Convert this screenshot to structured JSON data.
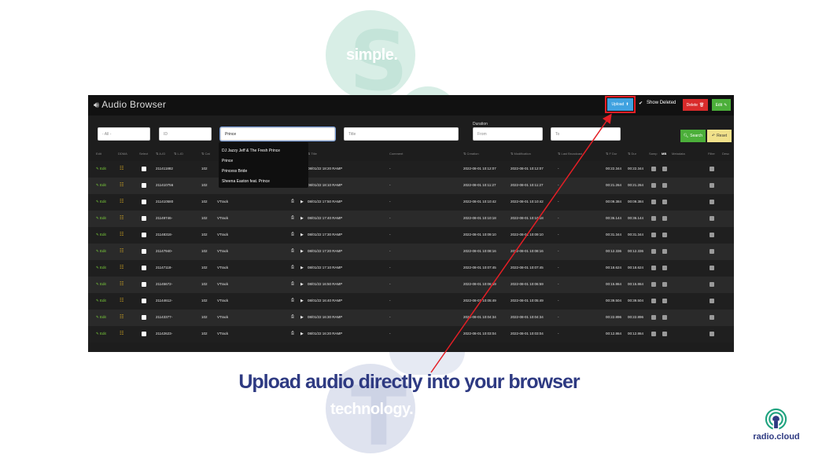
{
  "decor": {
    "top_word": "simple.",
    "top_letter": "S",
    "bottom_word": "technology.",
    "bottom_letter": "T"
  },
  "app": {
    "title": "Audio Browser",
    "toolbar": {
      "upload_label": "Upload",
      "show_deleted_label": "Show Deleted",
      "delete_label": "Delete",
      "edit_label": "Edit"
    },
    "filters": {
      "category": "- All -",
      "id_placeholder": "ID",
      "artist_value": "Prince",
      "title_placeholder": "Title",
      "duration_label": "Duration",
      "from_placeholder": "From",
      "to_placeholder": "To",
      "search_label": "Search",
      "reset_label": "Reset"
    },
    "autocomplete": [
      "DJ Jazzy Jeff & The Fresh Prince",
      "Prince",
      "Princess Bride",
      "Sheena Easton feat. Prince"
    ],
    "columns": {
      "edit": "Edit",
      "dima": "DDMA",
      "select": "Select",
      "aid": "A-ID",
      "lid": "L-ID",
      "cat": "Cat",
      "title": "Title",
      "comment": "Comment",
      "creation": "Creation",
      "modification": "Modification",
      "last_broadcast": "Last Broadcast",
      "fdur": "F Dur",
      "dur": "Dur",
      "samp": "Samp",
      "mb": "MB",
      "metadata": "Metadata",
      "filter": "Filter",
      "desc": "Desc"
    },
    "rows": [
      {
        "edit": "Edit",
        "aid": "211411882",
        "cat": "102",
        "type": "",
        "title": "08/01/22 18:20 RAMP",
        "comment": "-",
        "creation": "2022-08-01 10:12:07",
        "modification": "2022-08-01 10:12:07",
        "last": "-",
        "fdur": "00:22.344",
        "dur": "00:22.344"
      },
      {
        "edit": "Edit",
        "aid": "211410756",
        "cat": "102",
        "type": "",
        "title": "08/01/22 18:10 RAMP",
        "comment": "-",
        "creation": "2022-08-01 10:11:27",
        "modification": "2022-08-01 10:11:27",
        "last": "-",
        "fdur": "00:21.264",
        "dur": "00:21.264"
      },
      {
        "edit": "Edit",
        "aid": "211410580",
        "cat": "102",
        "type": "VTrack",
        "title": "08/01/22 17:50 RAMP",
        "comment": "-",
        "creation": "2022-08-01 10:10:42",
        "modification": "2022-08-01 10:10:42",
        "last": "-",
        "fdur": "00:09.384",
        "dur": "00:09.384"
      },
      {
        "edit": "Edit",
        "aid": "21149746-",
        "cat": "102",
        "type": "VTrack",
        "title": "08/01/22 17:40 RAMP",
        "comment": "-",
        "creation": "2022-08-01 10:10:18",
        "modification": "2022-08-01 10:10:18",
        "last": "-",
        "fdur": "00:36.144",
        "dur": "00:36.144"
      },
      {
        "edit": "Edit",
        "aid": "21148318-",
        "cat": "102",
        "type": "VTrack",
        "title": "08/01/22 17:30 RAMP",
        "comment": "-",
        "creation": "2022-08-01 10:09:10",
        "modification": "2022-08-01 10:09:10",
        "last": "-",
        "fdur": "00:31.344",
        "dur": "00:31.344"
      },
      {
        "edit": "Edit",
        "aid": "21147940-",
        "cat": "102",
        "type": "VTrack",
        "title": "08/01/22 17:20 RAMP",
        "comment": "-",
        "creation": "2022-08-01 10:08:16",
        "modification": "2022-08-01 10:08:16",
        "last": "-",
        "fdur": "00:12.336",
        "dur": "00:12.336"
      },
      {
        "edit": "Edit",
        "aid": "21147118-",
        "cat": "102",
        "type": "VTrack",
        "title": "08/01/22 17:10 RAMP",
        "comment": "-",
        "creation": "2022-08-01 10:07:45",
        "modification": "2022-08-01 10:07:45",
        "last": "-",
        "fdur": "00:18.624",
        "dur": "00:18.624"
      },
      {
        "edit": "Edit",
        "aid": "21145672-",
        "cat": "102",
        "type": "VTrack",
        "title": "08/01/22 16:50 RAMP",
        "comment": "-",
        "creation": "2022-08-01 10:06:59",
        "modification": "2022-08-01 10:06:59",
        "last": "-",
        "fdur": "00:15.864",
        "dur": "00:15.864"
      },
      {
        "edit": "Edit",
        "aid": "21144612-",
        "cat": "102",
        "type": "VTrack",
        "title": "08/01/22 16:40 RAMP",
        "comment": "-",
        "creation": "2022-08-01 10:05:49",
        "modification": "2022-08-01 10:05:49",
        "last": "-",
        "fdur": "00:39.504",
        "dur": "00:39.504"
      },
      {
        "edit": "Edit",
        "aid": "21143377-",
        "cat": "102",
        "type": "VTrack",
        "title": "08/01/22 16:30 RAMP",
        "comment": "-",
        "creation": "2022-08-01 10:04:34",
        "modification": "2022-08-01 10:04:34",
        "last": "-",
        "fdur": "00:22.896",
        "dur": "00:22.896"
      },
      {
        "edit": "Edit",
        "aid": "21142623-",
        "cat": "102",
        "type": "VTrack",
        "title": "08/01/22 16:20 RAMP",
        "comment": "-",
        "creation": "2022-08-01 10:03:04",
        "modification": "2022-08-01 10:03:04",
        "last": "-",
        "fdur": "00:12.864",
        "dur": "00:12.864"
      }
    ]
  },
  "caption": "Upload audio directly into your browser",
  "brand": "radio.cloud",
  "colors": {
    "accent_red": "#e41e25",
    "upload_blue": "#3fa2e0",
    "caption_navy": "#2e3a82",
    "brand_teal": "#1fa37f",
    "edit_green": "#7cd13b"
  }
}
